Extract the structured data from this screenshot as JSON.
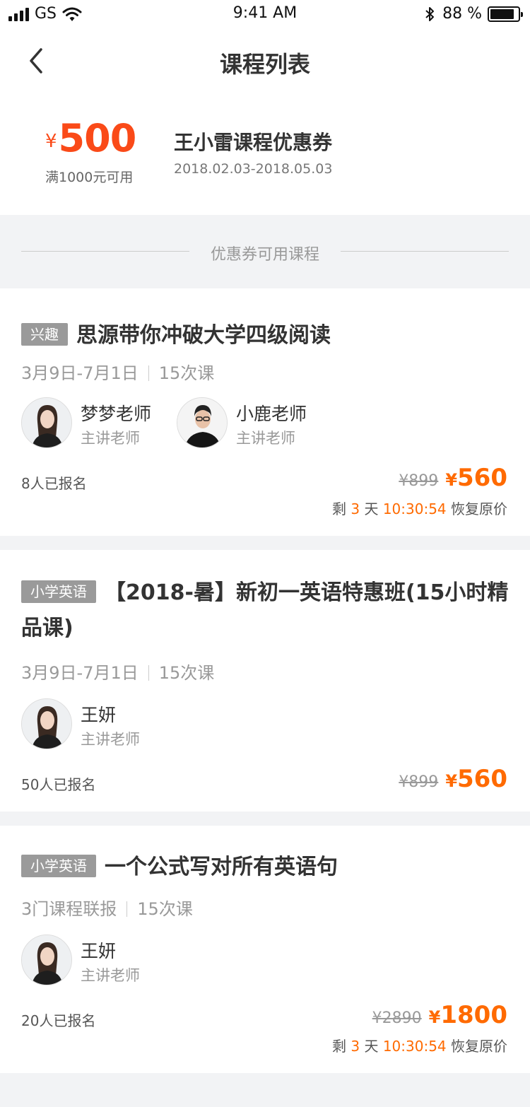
{
  "status_bar": {
    "carrier": "GS",
    "time": "9:41 AM",
    "battery_text": "88 %",
    "battery_level": 0.88
  },
  "nav": {
    "title": "课程列表",
    "back_icon": "chevron-left-icon"
  },
  "coupon": {
    "currency": "¥",
    "amount": "500",
    "condition": "满1000元可用",
    "name": "王小雷课程优惠券",
    "validity": "2018.02.03-2018.05.03"
  },
  "divider_label": "优惠券可用课程",
  "colors": {
    "accent": "#ff6a00",
    "coupon_red": "#fa4a18",
    "tag_gray": "#9a9a9a",
    "background": "#f2f3f5"
  },
  "courses": [
    {
      "tag": "兴趣",
      "title": "思源带你冲破大学四级阅读",
      "date_range": "3月9日-7月1日",
      "lessons": "15次课",
      "teachers": [
        {
          "name": "梦梦老师",
          "role": "主讲老师"
        },
        {
          "name": "小鹿老师",
          "role": "主讲老师"
        }
      ],
      "enrolled": "8人已报名",
      "original_price": "¥899",
      "currency": "¥",
      "price": "560",
      "countdown": {
        "prefix": "剩",
        "days": "3",
        "unit": "天",
        "time": "10:30:54",
        "suffix": "恢复原价"
      }
    },
    {
      "tag": "小学英语",
      "title": "【2018-暑】新初一英语特惠班(15小时精品课)",
      "date_range": "3月9日-7月1日",
      "lessons": "15次课",
      "teachers": [
        {
          "name": "王妍",
          "role": "主讲老师"
        }
      ],
      "enrolled": "50人已报名",
      "original_price": "¥899",
      "currency": "¥",
      "price": "560"
    },
    {
      "tag": "小学英语",
      "title": "一个公式写对所有英语句",
      "date_range": "3门课程联报",
      "lessons": "15次课",
      "teachers": [
        {
          "name": "王妍",
          "role": "主讲老师"
        }
      ],
      "enrolled": "20人已报名",
      "original_price": "¥2890",
      "currency": "¥",
      "price": "1800",
      "countdown": {
        "prefix": "剩",
        "days": "3",
        "unit": "天",
        "time": "10:30:54",
        "suffix": "恢复原价"
      }
    }
  ]
}
